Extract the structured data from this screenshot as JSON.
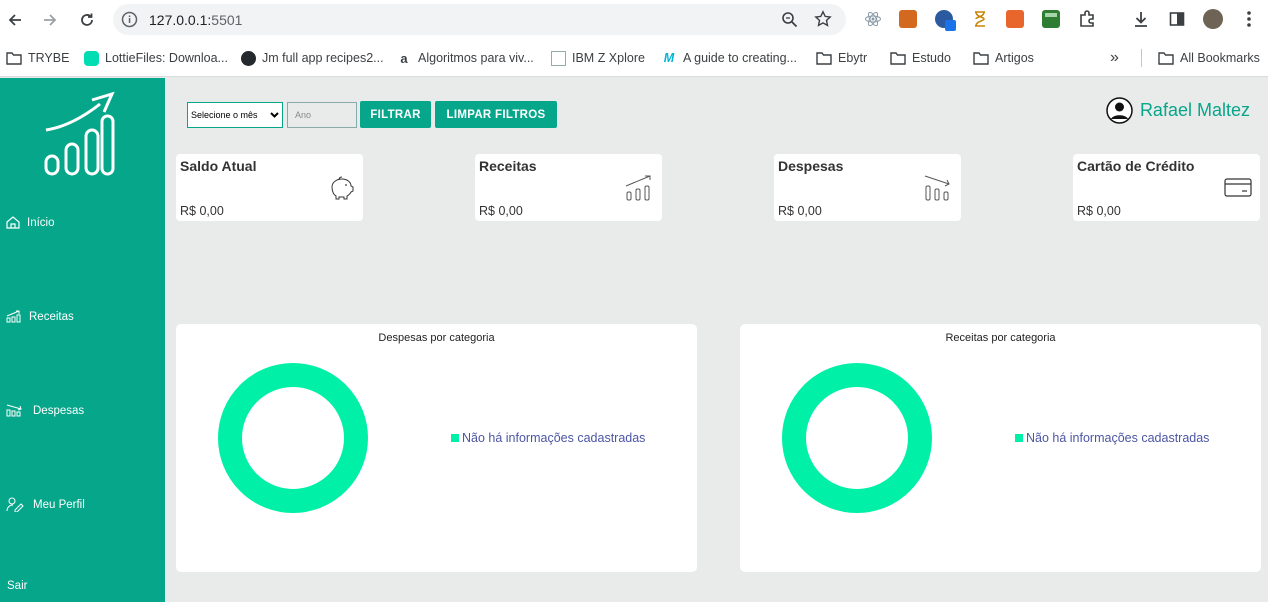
{
  "browser": {
    "url_host": "127.0.0.1:",
    "url_port": "5501",
    "bookmarks": [
      {
        "label": "TRYBE"
      },
      {
        "label": "LottieFiles: Downloa..."
      },
      {
        "label": "Jm full app recipes2..."
      },
      {
        "label": "Algoritmos para viv..."
      },
      {
        "label": "IBM Z Xplore"
      },
      {
        "label": "A guide to creating..."
      },
      {
        "label": "Ebytr"
      },
      {
        "label": "Estudo"
      },
      {
        "label": "Artigos"
      }
    ],
    "more_bookmarks": "»",
    "all_bookmarks": "All Bookmarks"
  },
  "sidebar": {
    "items": [
      {
        "label": "Início",
        "icon": "home-icon"
      },
      {
        "label": "Receitas",
        "icon": "chart-up-icon"
      },
      {
        "label": "Despesas",
        "icon": "chart-down-icon"
      },
      {
        "label": "Meu Perfil",
        "icon": "user-edit-icon"
      },
      {
        "label": "Sair"
      }
    ]
  },
  "filters": {
    "month_select": "Selecione o mês",
    "year_placeholder": "Ano",
    "filter_button": "FILTRAR",
    "clear_button": "LIMPAR FILTROS"
  },
  "user": {
    "name": "Rafael Maltez"
  },
  "cards": [
    {
      "title": "Saldo Atual",
      "value": "R$ 0,00",
      "icon": "piggy-bank-icon"
    },
    {
      "title": "Receitas",
      "value": "R$ 0,00",
      "icon": "chart-up-icon"
    },
    {
      "title": "Despesas",
      "value": "R$ 0,00",
      "icon": "chart-down-icon"
    },
    {
      "title": "Cartão de Crédito",
      "value": "R$ 0,00",
      "icon": "credit-card-icon"
    }
  ],
  "panels": [
    {
      "title": "Despesas por categoria",
      "legend": "Não há informações cadastradas"
    },
    {
      "title": "Receitas por categoria",
      "legend": "Não há informações cadastradas"
    }
  ],
  "colors": {
    "accent": "#06a68a",
    "donut": "#00f0a8",
    "legend_text": "#4c56a4"
  }
}
